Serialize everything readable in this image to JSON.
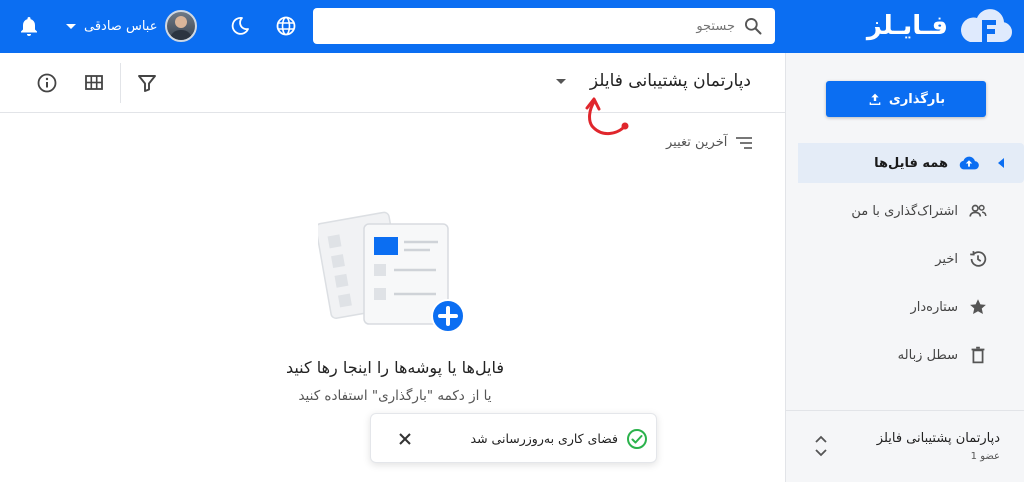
{
  "brand": {
    "name": "فـایـلز",
    "accent": "#0b6ef2"
  },
  "search": {
    "placeholder": "جستجو"
  },
  "user": {
    "name": "عباس صادقی"
  },
  "sidebar": {
    "upload_label": "بارگذاری",
    "items": [
      {
        "label": "همه فایل‌ها",
        "icon": "cloud-upload-icon",
        "active": true
      },
      {
        "label": "اشتراک‌گذاری با من",
        "icon": "people-icon"
      },
      {
        "label": "اخیر",
        "icon": "history-icon"
      },
      {
        "label": "ستاره‌دار",
        "icon": "star-icon"
      },
      {
        "label": "سطل زباله",
        "icon": "trash-icon"
      }
    ],
    "team": {
      "name": "دپارتمان پشتیبانی فایلز",
      "members": "1 عضو"
    }
  },
  "content": {
    "title": "دپارتمان پشتیبانی فایلز",
    "sort_label": "آخرین تغییر",
    "empty_title": "فایل‌ها یا پوشه‌ها را اینجا رها کنید",
    "empty_subtitle": "یا از دکمه \"بارگذاری\" استفاده کنید"
  },
  "toast": {
    "message": "فضای کاری به‌روزرسانی شد",
    "status_color": "#2bb24c"
  }
}
